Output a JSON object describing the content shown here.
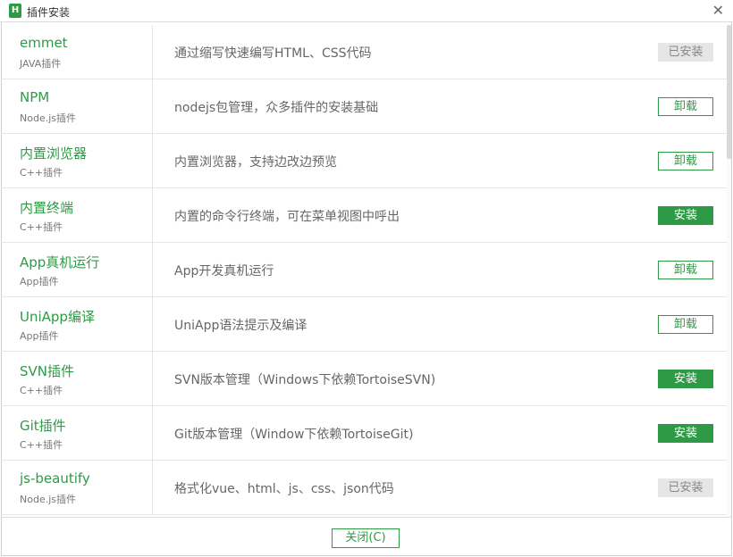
{
  "window": {
    "title": "插件安装",
    "icon_glyph": "H",
    "close_glyph": "✕"
  },
  "colors": {
    "accent": "#2f9a45",
    "installed_bg": "#e6e6e6",
    "installed_text": "#888888"
  },
  "plugins": [
    {
      "name": "emmet",
      "category": "JAVA插件",
      "description": "通过缩写快速编写HTML、CSS代码",
      "action": "已安装",
      "state": "installed"
    },
    {
      "name": "NPM",
      "category": "Node.js插件",
      "description": "nodejs包管理，众多插件的安装基础",
      "action": "卸载",
      "state": "uninstall"
    },
    {
      "name": "内置浏览器",
      "category": "C++插件",
      "description": "内置浏览器，支持边改边预览",
      "action": "卸载",
      "state": "uninstall"
    },
    {
      "name": "内置终端",
      "category": "C++插件",
      "description": "内置的命令行终端，可在菜单视图中呼出",
      "action": "安装",
      "state": "install"
    },
    {
      "name": "App真机运行",
      "category": "App插件",
      "description": "App开发真机运行",
      "action": "卸载",
      "state": "uninstall"
    },
    {
      "name": "UniApp编译",
      "category": "App插件",
      "description": "UniApp语法提示及编译",
      "action": "卸载",
      "state": "uninstall"
    },
    {
      "name": "SVN插件",
      "category": "C++插件",
      "description": "SVN版本管理（Windows下依赖TortoiseSVN)",
      "action": "安装",
      "state": "install"
    },
    {
      "name": "Git插件",
      "category": "C++插件",
      "description": "Git版本管理（Window下依赖TortoiseGit)",
      "action": "安装",
      "state": "install"
    },
    {
      "name": "js-beautify",
      "category": "Node.js插件",
      "description": "格式化vue、html、js、css、json代码",
      "action": "已安装",
      "state": "installed"
    }
  ],
  "footer": {
    "close_label": "关闭(C)"
  }
}
